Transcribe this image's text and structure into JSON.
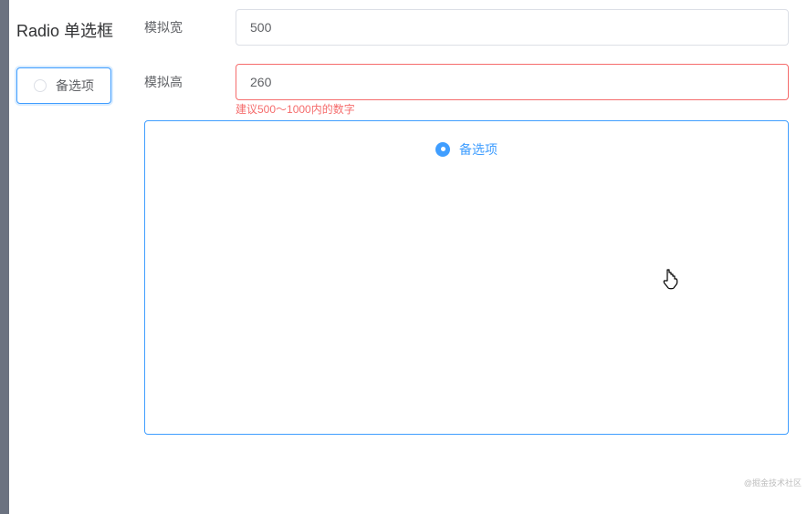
{
  "heading": "Radio 单选框",
  "left_radio": {
    "label": "备选项"
  },
  "form": {
    "width": {
      "label": "模拟宽",
      "value": "500"
    },
    "height": {
      "label": "模拟高",
      "value": "260",
      "error": "建议500～1000内的数字"
    }
  },
  "preview_radio": {
    "label": "备选项"
  },
  "watermark": "@掘金技术社区"
}
